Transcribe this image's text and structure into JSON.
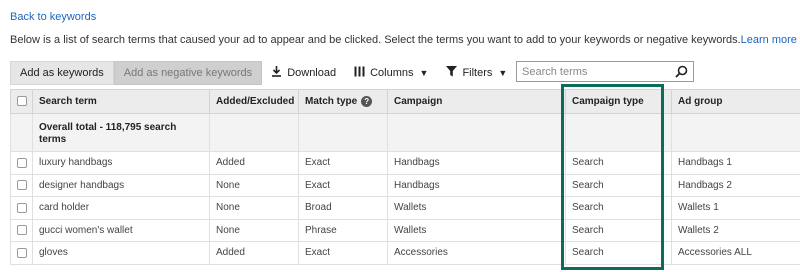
{
  "back_link": "Back to keywords",
  "description": "Below is a list of search terms that caused your ad to appear and be clicked. Select the terms you want to add to your keywords or negative keywords.",
  "learn_more": "Learn more",
  "toolbar": {
    "add_keywords": "Add as keywords",
    "add_negative": "Add as negative keywords",
    "download": "Download",
    "columns": "Columns",
    "filters": "Filters",
    "search_placeholder": "Search terms"
  },
  "table": {
    "headers": {
      "search_term": "Search term",
      "added_excluded": "Added/Excluded",
      "match_type": "Match type",
      "campaign": "Campaign",
      "campaign_type": "Campaign type",
      "ad_group": "Ad group"
    },
    "total_label": "Overall total - 118,795 search terms",
    "rows": [
      {
        "term": "luxury handbags",
        "status": "Added",
        "match": "Exact",
        "campaign": "Handbags",
        "type": "Search",
        "ad_group": "Handbags 1"
      },
      {
        "term": "designer handbags",
        "status": "None",
        "match": "Exact",
        "campaign": "Handbags",
        "type": "Search",
        "ad_group": "Handbags 2"
      },
      {
        "term": "card holder",
        "status": "None",
        "match": "Broad",
        "campaign": "Wallets",
        "type": "Search",
        "ad_group": "Wallets 1"
      },
      {
        "term": "gucci women's wallet",
        "status": "None",
        "match": "Phrase",
        "campaign": "Wallets",
        "type": "Search",
        "ad_group": "Wallets 2"
      },
      {
        "term": "gloves",
        "status": "Added",
        "match": "Exact",
        "campaign": "Accessories",
        "type": "Search",
        "ad_group": "Accessories ALL"
      }
    ]
  },
  "colors": {
    "link": "#1a66c4",
    "highlight_border": "#0d6b5a",
    "header_bg": "#ececec"
  }
}
